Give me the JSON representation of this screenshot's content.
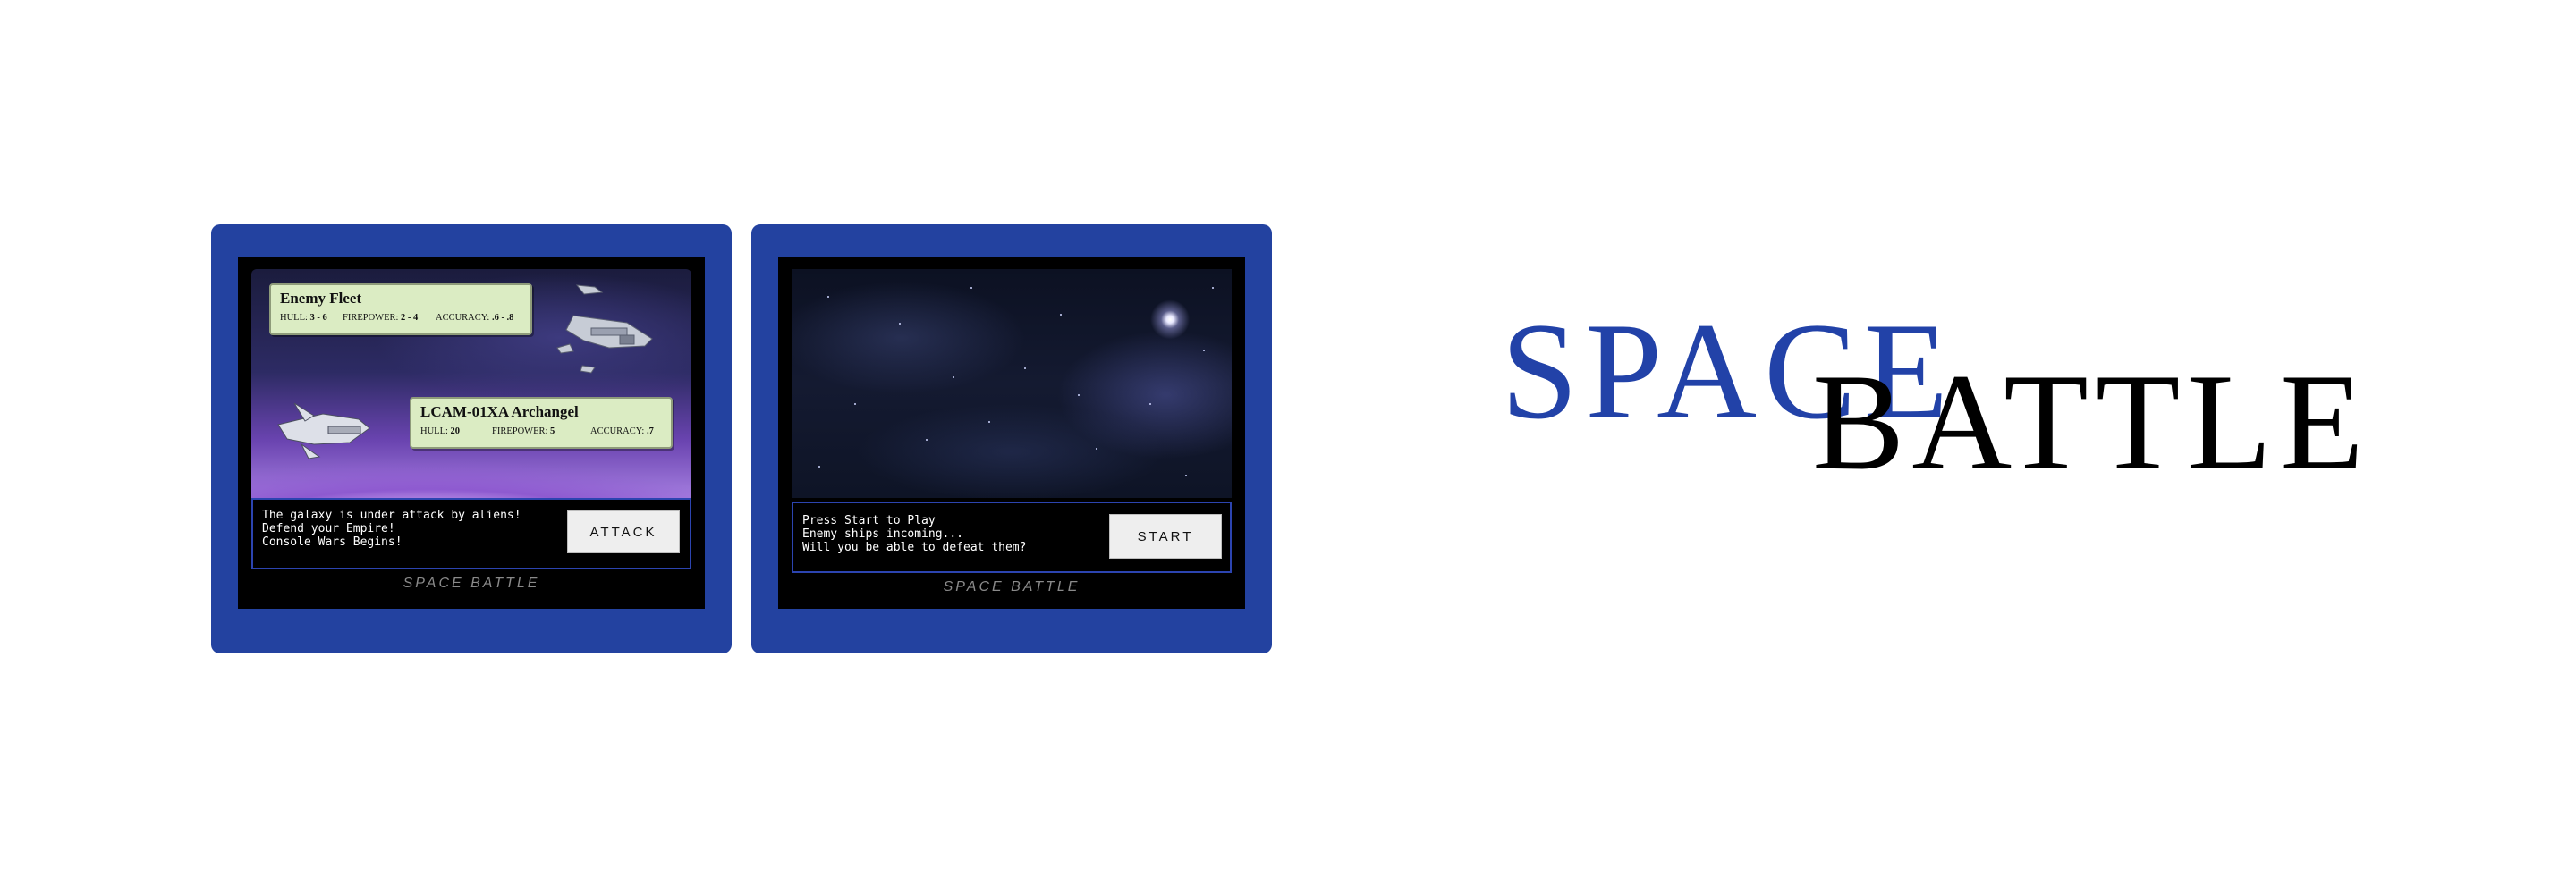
{
  "left_console": {
    "enemy_card": {
      "title": "Enemy Fleet",
      "hull_label": "HULL:",
      "hull_value": "3 - 6",
      "firepower_label": "FIREPOWER:",
      "firepower_value": "2 - 4",
      "accuracy_label": "ACCURACY:",
      "accuracy_value": ".6 - .8"
    },
    "player_card": {
      "title": "LCAM-01XA Archangel",
      "hull_label": "HULL:",
      "hull_value": "20",
      "firepower_label": "FIREPOWER:",
      "firepower_value": "5",
      "accuracy_label": "ACCURACY:",
      "accuracy_value": ".7"
    },
    "message_lines": [
      "The galaxy is under attack by aliens!",
      "Defend your Empire!",
      "Console Wars Begins!"
    ],
    "button_label": "ATTACK",
    "console_label": "SPACE BATTLE"
  },
  "right_console": {
    "message_lines": [
      "Press Start to Play",
      "Enemy ships incoming...",
      "Will you be able to defeat them?"
    ],
    "button_label": "START",
    "console_label": "SPACE BATTLE"
  },
  "title": {
    "word1": "SPACE",
    "word2": "BATTLE"
  },
  "colors": {
    "console_blue": "#2342a0",
    "title_blue": "#2242a8",
    "card_green": "#dbecc3"
  }
}
